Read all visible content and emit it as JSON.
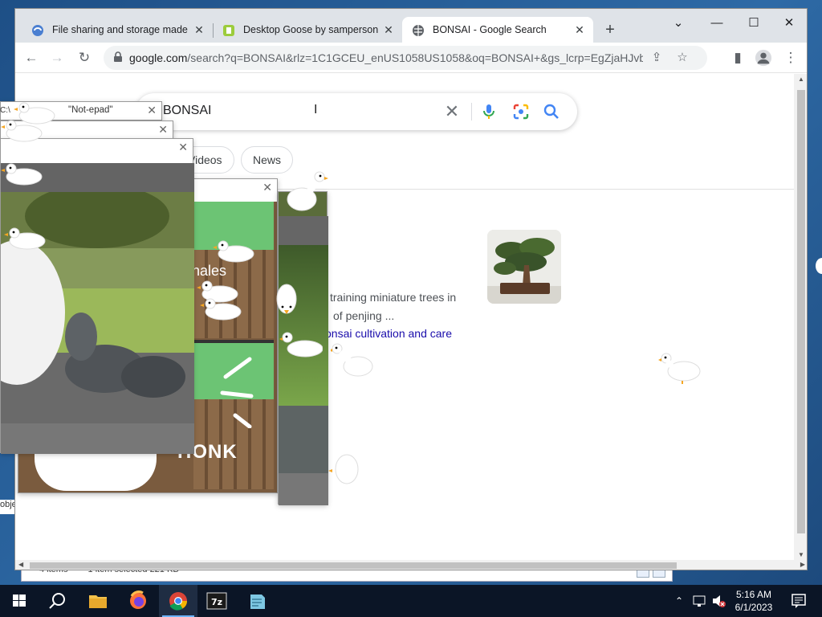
{
  "browser": {
    "tabs": [
      {
        "title": "File sharing and storage made si",
        "active": false
      },
      {
        "title": "Desktop Goose by samperson",
        "active": false
      },
      {
        "title": "BONSAI - Google Search",
        "active": true
      }
    ],
    "address": {
      "host": "google.com",
      "path": "/search?q=BONSAI&rlz=1C1GCEU_enUS1058US1058&oq=BONSAI+&gs_lcrp=EgZjaHJvbWUy..."
    }
  },
  "google": {
    "query": "BONSAI",
    "filters": [
      "Videos",
      "News"
    ],
    "snippet_lines": [
      "training miniature trees in",
      "of penjing ..."
    ],
    "link_text": "onsai cultivation and care"
  },
  "popups": {
    "notepad_title": "\"Not-epad\"",
    "meme_caption": "hales",
    "honk_text": "HONK"
  },
  "edge_text": {
    "left_cv": "C:\\",
    "left_obj": "obje"
  },
  "explorer_status": {
    "items": "4 items",
    "selected": "1 item selected  221 KB"
  },
  "taskbar": {
    "time": "5:16 AM",
    "date": "6/1/2023"
  },
  "colors": {
    "chrome_tabstrip": "#dfe3e8",
    "google_blue": "#4285f4",
    "link": "#1a0dab",
    "taskbar": "#0b1526"
  }
}
